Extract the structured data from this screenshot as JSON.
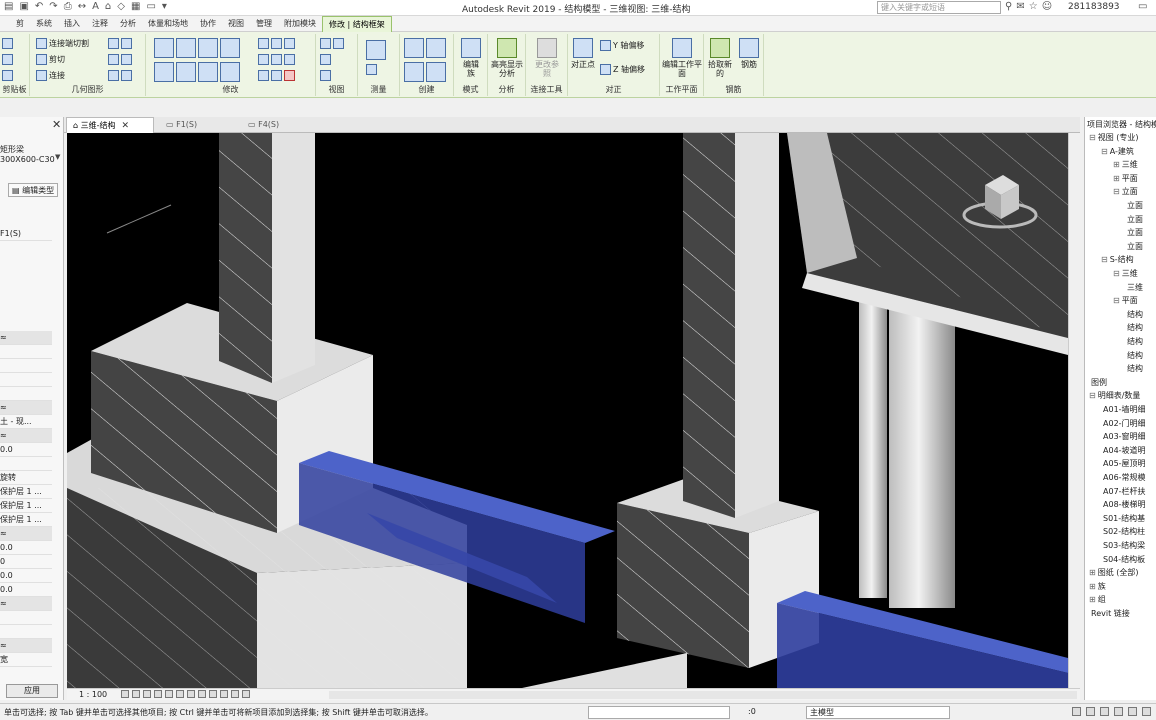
{
  "title_bar": {
    "app_title": "Autodesk Revit 2019 - 结构模型 - 三维视图: 三维-结构",
    "search_placeholder": "键入关键字或短语",
    "user": "281183893"
  },
  "ribbon_tabs": [
    "剪",
    "系统",
    "插入",
    "注释",
    "分析",
    "体量和场地",
    "协作",
    "视图",
    "管理",
    "附加模块",
    "修改 | 结构框架"
  ],
  "active_ribbon_tab": "修改 | 结构框架",
  "ribbon_groups": {
    "clipboard": {
      "label": "剪贴板"
    },
    "geometry": {
      "label": "几何图形",
      "items": [
        "连接端切割",
        "剪切",
        "连接"
      ]
    },
    "modify": {
      "label": "修改"
    },
    "view": {
      "label": "视图"
    },
    "measure": {
      "label": "测量"
    },
    "create": {
      "label": "创建"
    },
    "mode": {
      "label": "模式",
      "button": "编辑族"
    },
    "analysis": {
      "label": "分析",
      "button": "高亮显示分析"
    },
    "join_tools": {
      "label": "连接工具",
      "button": "更改参照"
    },
    "justify": {
      "label": "对正",
      "items": [
        "对正点",
        "Y 轴偏移",
        "Z 轴偏移"
      ]
    },
    "work_plane": {
      "label": "工作平面",
      "button": "编辑工作平面"
    },
    "rebar": {
      "label": "钢筋",
      "items": [
        "拾取新的",
        "钢筋"
      ]
    }
  },
  "properties": {
    "type_line1": "矩形梁",
    "type_line2": "300X600-C30",
    "edit_type": "编辑类型",
    "filter_value": "F1(S)",
    "rows": [
      "≈",
      "",
      "",
      "",
      "",
      "≈",
      "土 - 现...",
      "≈",
      "0.0",
      "",
      "旋转",
      "保护层 1 ...",
      "保护层 1 ...",
      "保护层 1 ...",
      "≈",
      "0.0",
      "0",
      "0.0",
      "0.0",
      "≈",
      "",
      "",
      "≈",
      "宽"
    ],
    "apply": "应用"
  },
  "view_tabs": [
    {
      "label": "三维-结构",
      "active": true
    },
    {
      "label": "F1(S)",
      "active": false
    },
    {
      "label": "F4(S)",
      "active": false
    }
  ],
  "view_control": {
    "scale": "1 : 100"
  },
  "project_browser": {
    "title": "项目浏览器 - 结构模型",
    "items": [
      {
        "label": "视图 (专业)",
        "indent": 0,
        "toggle": "⊟"
      },
      {
        "label": "A-建筑",
        "indent": 1,
        "toggle": "⊟"
      },
      {
        "label": "三维",
        "indent": 2,
        "toggle": "⊞"
      },
      {
        "label": "平面",
        "indent": 2,
        "toggle": "⊞"
      },
      {
        "label": "立面",
        "indent": 2,
        "toggle": "⊟"
      },
      {
        "label": "立面",
        "indent": 3,
        "toggle": ""
      },
      {
        "label": "立面",
        "indent": 3,
        "toggle": ""
      },
      {
        "label": "立面",
        "indent": 3,
        "toggle": ""
      },
      {
        "label": "立面",
        "indent": 3,
        "toggle": ""
      },
      {
        "label": "S-结构",
        "indent": 1,
        "toggle": "⊟"
      },
      {
        "label": "三维",
        "indent": 2,
        "toggle": "⊟"
      },
      {
        "label": "三维",
        "indent": 3,
        "toggle": ""
      },
      {
        "label": "平面",
        "indent": 2,
        "toggle": "⊟"
      },
      {
        "label": "结构",
        "indent": 3,
        "toggle": ""
      },
      {
        "label": "结构",
        "indent": 3,
        "toggle": ""
      },
      {
        "label": "结构",
        "indent": 3,
        "toggle": ""
      },
      {
        "label": "结构",
        "indent": 3,
        "toggle": ""
      },
      {
        "label": "结构",
        "indent": 3,
        "toggle": ""
      },
      {
        "label": "图例",
        "indent": 0,
        "toggle": ""
      },
      {
        "label": "明细表/数量",
        "indent": 0,
        "toggle": "⊟"
      },
      {
        "label": "A01-墙明细",
        "indent": 1,
        "toggle": ""
      },
      {
        "label": "A02-门明细",
        "indent": 1,
        "toggle": ""
      },
      {
        "label": "A03-窗明细",
        "indent": 1,
        "toggle": ""
      },
      {
        "label": "A04-坡道明",
        "indent": 1,
        "toggle": ""
      },
      {
        "label": "A05-屋顶明",
        "indent": 1,
        "toggle": ""
      },
      {
        "label": "A06-常规模",
        "indent": 1,
        "toggle": ""
      },
      {
        "label": "A07-栏杆扶",
        "indent": 1,
        "toggle": ""
      },
      {
        "label": "A08-楼梯明",
        "indent": 1,
        "toggle": ""
      },
      {
        "label": "S01-结构基",
        "indent": 1,
        "toggle": ""
      },
      {
        "label": "S02-结构柱",
        "indent": 1,
        "toggle": ""
      },
      {
        "label": "S03-结构梁",
        "indent": 1,
        "toggle": ""
      },
      {
        "label": "S04-结构板",
        "indent": 1,
        "toggle": ""
      },
      {
        "label": "图纸 (全部)",
        "indent": 0,
        "toggle": "⊞"
      },
      {
        "label": "族",
        "indent": 0,
        "toggle": "⊞"
      },
      {
        "label": "组",
        "indent": 0,
        "toggle": "⊞"
      },
      {
        "label": "Revit 链接",
        "indent": 0,
        "toggle": ""
      }
    ]
  },
  "status_bar": {
    "message": "单击可选择; 按 Tab 键并单击可选择其他项目; 按 Ctrl 键并单击可将新项目添加到选择集; 按 Shift 键并单击可取消选择。",
    "zero": ":0",
    "model": "主模型"
  }
}
